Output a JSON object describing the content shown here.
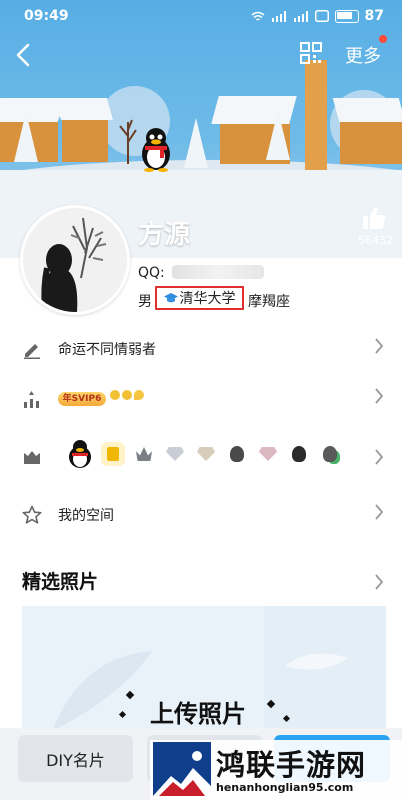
{
  "status_bar": {
    "time": "09:49",
    "battery": "87"
  },
  "nav": {
    "more_label": "更多"
  },
  "profile": {
    "name": "方源",
    "likes": "56432",
    "qq_label": "QQ:",
    "gender": "男",
    "school": "清华大学",
    "zodiac": "摩羯座"
  },
  "rows": {
    "signature": "命运不同情弱者",
    "vip_badge": "年SVIP6",
    "space": "我的空间"
  },
  "photos": {
    "section_title": "精选照片",
    "upload_label": "上传照片"
  },
  "bottom": {
    "diy_label": "DIY名片"
  },
  "watermark": {
    "title": "鸿联手游网",
    "url": "henanhonglian95.com"
  },
  "colors": {
    "accent": "#29a3f2",
    "highlight_box": "#e02d2d",
    "sky": "#5eb2e6"
  }
}
